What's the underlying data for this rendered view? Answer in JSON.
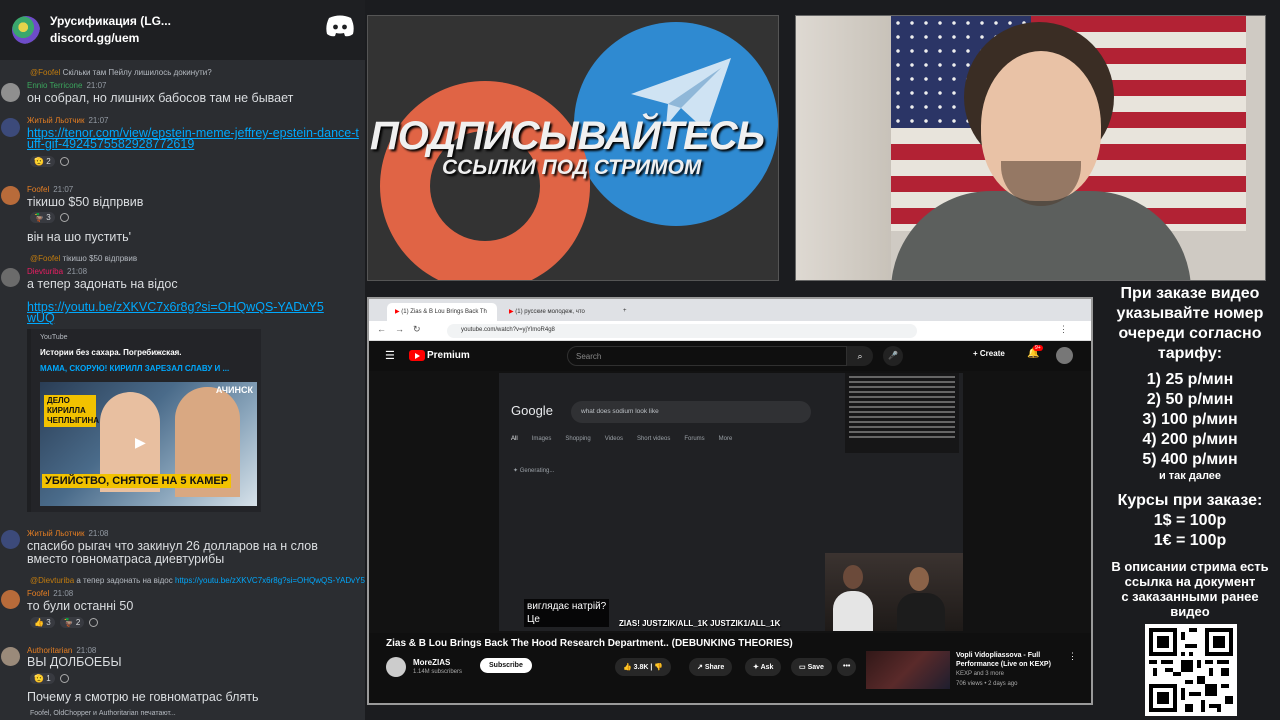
{
  "chat": {
    "server_name": "Урусификация (LG...",
    "server_link": "discord.gg/uem",
    "messages": [
      {
        "reply_user": "@Foofel",
        "reply_text": "Скільки там Пейлу лишилось докинути?",
        "user": "Ennio Terricone",
        "user_color": "#3ba55d",
        "time": "21:07",
        "text": "он собрал, но лишних бабосов там не бывает"
      },
      {
        "user": "Житый Льотчик",
        "user_color": "#e67e22",
        "time": "21:07",
        "link": "https://tenor.com/view/epstein-meme-jeffrey-epstein-dance-tuff-gif-4924575582928772619",
        "reactions": [
          "2"
        ]
      },
      {
        "user": "Foofel",
        "user_color": "#e67e22",
        "time": "21:07",
        "text": "тікишо $50 відпрвив",
        "reactions": [
          "3"
        ],
        "text2": "він на шо пустить'"
      },
      {
        "reply_user": "@Foofel",
        "reply_text": "тікишо $50 відпрвив",
        "user": "Dievturiba",
        "user_color": "#e91e63",
        "time": "21:08",
        "text": "а тепер задонать на відос",
        "link": "https://youtu.be/zXKVC7x6r8g?si=OHQwQS-YADvY5wUQ"
      },
      {
        "user": "Житый Льотчик",
        "user_color": "#e67e22",
        "time": "21:08",
        "text": "спасибо рыгач что закинул 26 долларов на н слов",
        "text2": "вместо говноматраса диевтурибы"
      },
      {
        "reply_user": "@Dievturiba",
        "reply_text": "а тепер задонать на відос",
        "reply_link": "https://youtu.be/zXKVC7x6r8g?si=OHQwQS-YADvY5wUQ",
        "user": "Foofel",
        "user_color": "#e67e22",
        "time": "21:08",
        "text": "то були останні 50",
        "reactions": [
          "3",
          "2"
        ]
      },
      {
        "user": "Authoritarian",
        "user_color": "#e67e22",
        "time": "21:08",
        "text": "ВЫ ДОЛБОЕБЫ",
        "reactions": [
          "1"
        ],
        "text2": "Почему я смотрю не говноматрас блять"
      }
    ],
    "embed": {
      "provider": "YouTube",
      "author": "Истории без сахара. Погребижская.",
      "title": "МАМА, СКОРУЮ! КИРИЛЛ ЗАРЕЗАЛ СЛАВУ И ...",
      "thumb_badge": "ДЕЛО КИРИЛЛА ЧЕПЛЫГИНА",
      "thumb_city": "АЧИНСК",
      "thumb_caption": "УБИЙСТВО, СНЯТОЕ НА 5 КАМЕР"
    },
    "typing": "Foofel, OldChopper и Authoritarian печатают..."
  },
  "promo": {
    "headline": "ПОДПИСЫВАЙТЕСЬ",
    "subline": "ССЫЛКИ ПОД СТРИМОМ"
  },
  "browser": {
    "tab1": "(1) Zias & B Lou Brings Back Th",
    "tab2": "(1) русские молодеж, что",
    "url": "youtube.com/watch?v=yjYlmoR4g8",
    "premium": "Premium",
    "search_placeholder": "Search",
    "create": "Create",
    "notif_count": "9+",
    "google_logo": "Google",
    "google_query": "what does sodium look like",
    "google_tabs": [
      "All",
      "Images",
      "Shopping",
      "Videos",
      "Short videos",
      "Forums",
      "More"
    ],
    "generating": "Generating...",
    "subtitle_line1": "виглядає натрій?",
    "subtitle_line2": "Це",
    "handles": "ZIAS! JUSTZIK/ALL_1K JUSTZIK1/ALL_1K",
    "video_title": "Zias & B Lou Brings Back The Hood Research Department.. (DEBUNKING THEORIES)",
    "channel": "MoreZIAS",
    "subscribers": "1.14M subscribers",
    "subscribe": "Subscribe",
    "likes": "3.8K",
    "share": "Share",
    "ask": "Ask",
    "save": "Save",
    "rec_title": "Vopli Vidopliassova - Full Performance (Live on KEXP)",
    "rec_channel": "KEXP and 3 more",
    "rec_views": "706 views • 2 days ago"
  },
  "order": {
    "intro": [
      "При заказе видео",
      "указывайте номер",
      "очереди согласно",
      "тарифу:"
    ],
    "tariffs": [
      "1) 25 р/мин",
      "2) 50 р/мин",
      "3) 100 р/мин",
      "4) 200 р/мин",
      "5) 400 р/мин"
    ],
    "etc": "и так далее",
    "rates_title": "Курсы при заказе:",
    "rates": [
      "1$ = 100р",
      "1€ = 100р"
    ],
    "desc": [
      "В описании стрима есть",
      "ссылка на документ",
      "с заказанными ранее",
      "видео"
    ]
  },
  "colors": {
    "discord_bg": "#2b2d31",
    "link": "#00a8fc",
    "youtube_red": "#ff0000",
    "telegram_blue": "#2f8ad1",
    "patreon_orange": "#e06445"
  }
}
